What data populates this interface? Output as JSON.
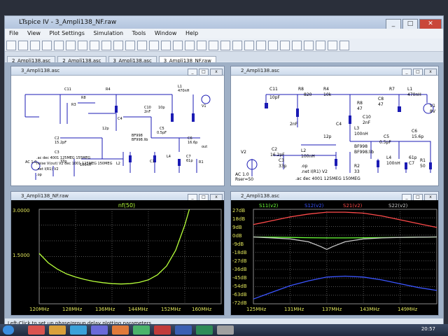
{
  "app": {
    "title": "LTspice IV - 3_Ampli138_NF.raw",
    "menu": [
      "File",
      "View",
      "Plot Settings",
      "Simulation",
      "Tools",
      "Window",
      "Help"
    ],
    "tabs": [
      {
        "label": "2_Ampli138.asc",
        "active": false
      },
      {
        "label": "2_Ampli138.asc",
        "active": false
      },
      {
        "label": "3_Ampli138.asc",
        "active": false
      },
      {
        "label": "3_Ampli138_NF.raw",
        "active": true
      }
    ],
    "status_text": "Left-Click to set up phase/group delay plotting parameters",
    "clock": "20:57"
  },
  "panels": {
    "sch1": {
      "title": "3_Ampli138.asc",
      "directives": [
        ".ac dec 4001 125MEG 155MEG",
        "noise V(out) V2 dec 1001 125MEG 150MEG",
        ".net I(R1) V2",
        ".op"
      ],
      "parts": [
        "C11",
        "R8",
        "R4",
        "R3",
        "C4",
        "12p",
        "L1",
        "470nH",
        "C5",
        "C10",
        "2nF",
        "10p",
        "BF998",
        "BF998.lib",
        "C2",
        "15.2pF",
        "C1",
        "100nH",
        "R1",
        "C3",
        "33p",
        "L2",
        "L4",
        "C6",
        "C7",
        "61p",
        "16.6p",
        "out",
        "V1",
        "AC 1.0",
        "0.5pF"
      ]
    },
    "sch2": {
      "title": "2_Ampli138.asc",
      "directives": [
        ".op",
        ".net I(R1) V2",
        ".ac dec 4001 125MEG 150MEG"
      ],
      "parts": [
        "C11",
        "10pF",
        "R8",
        "820",
        "R4",
        "10k",
        "R8",
        "47",
        "C8",
        "47",
        "R7",
        "L1",
        "470nH",
        "V1",
        "8V",
        "C10",
        "2nF",
        "C4",
        "12p",
        "L3",
        "100nH",
        "C5",
        "0.5pF",
        "C6",
        "15.6p",
        "C2",
        "16.2pF",
        "L2",
        "100nH",
        "BF998",
        "BF998.lib",
        "R2",
        "33",
        "C3",
        "33p",
        "L4",
        "100nH",
        "61p",
        "C7",
        "R1",
        "50",
        "V2",
        "AC 1.0",
        "Rser=50",
        "2nF"
      ]
    },
    "plot1": {
      "title": "3_Ampli138_NF.raw",
      "trace_label": "nf(50)",
      "y_ticks": [
        "3.0000",
        "1.5000",
        "0.0000"
      ],
      "x_ticks": [
        "120MHz",
        "128MHz",
        "136MHz",
        "144MHz",
        "152MHz",
        "160MHz"
      ]
    },
    "plot2": {
      "title": "2_Ampli138.asc",
      "legend": [
        "S11(v2)",
        "S12(v2)",
        "S21(v2)",
        "S22(v2)"
      ],
      "y_ticks": [
        "27dB",
        "18dB",
        "9dB",
        "0dB",
        "-9dB",
        "-18dB",
        "-27dB",
        "-36dB",
        "-45dB",
        "-54dB",
        "-63dB",
        "-72dB"
      ],
      "x_ticks": [
        "125MHz",
        "131MHz",
        "137MHz",
        "143MHz",
        "149MHz"
      ]
    }
  },
  "chart_data": [
    {
      "type": "line",
      "title": "",
      "xlabel": "",
      "ylabel": "",
      "xlim": [
        120,
        160
      ],
      "ylim": [
        0,
        3
      ],
      "series": [
        {
          "name": "nf(50)",
          "color": "#b6ff3a",
          "x": [
            120,
            122,
            124,
            126,
            128,
            130,
            132,
            134,
            136,
            138,
            140,
            142,
            144,
            146,
            148,
            150,
            152,
            153
          ],
          "values": [
            1.6,
            1.3,
            1.1,
            0.95,
            0.85,
            0.77,
            0.71,
            0.67,
            0.64,
            0.63,
            0.64,
            0.68,
            0.76,
            0.92,
            1.2,
            1.7,
            2.5,
            3.0
          ]
        }
      ]
    },
    {
      "type": "line",
      "title": "",
      "xlabel": "",
      "ylabel": "",
      "xlim": [
        125,
        155
      ],
      "ylim": [
        -72,
        27
      ],
      "series": [
        {
          "name": "S11(v2)",
          "color": "#6cff3a",
          "x": [
            125,
            128,
            131,
            134,
            137,
            140,
            143,
            146,
            149,
            152,
            155
          ],
          "values": [
            -2,
            -2.2,
            -2.5,
            -2.8,
            -3.0,
            -3.0,
            -2.8,
            -2.6,
            -2.4,
            -2.2,
            -2.0
          ]
        },
        {
          "name": "S12(v2)",
          "color": "#3b55ff",
          "x": [
            125,
            128,
            131,
            134,
            137,
            140,
            143,
            146,
            149,
            152,
            155
          ],
          "values": [
            -67,
            -60,
            -53,
            -48,
            -44,
            -43,
            -44,
            -47,
            -51,
            -55,
            -58
          ]
        },
        {
          "name": "S21(v2)",
          "color": "#ff4a4a",
          "x": [
            125,
            128,
            131,
            134,
            137,
            140,
            143,
            146,
            149,
            152,
            155
          ],
          "values": [
            11,
            15,
            19,
            22,
            24,
            24,
            23,
            20,
            16,
            12,
            8
          ]
        },
        {
          "name": "S22(v2)",
          "color": "#c9c9c9",
          "x": [
            125,
            128,
            131,
            134,
            136,
            137,
            138,
            140,
            143,
            146,
            149,
            152,
            155
          ],
          "values": [
            -2,
            -3,
            -4,
            -7,
            -12,
            -15,
            -12,
            -7,
            -4,
            -3,
            -2.5,
            -2.2,
            -2
          ]
        }
      ]
    }
  ]
}
